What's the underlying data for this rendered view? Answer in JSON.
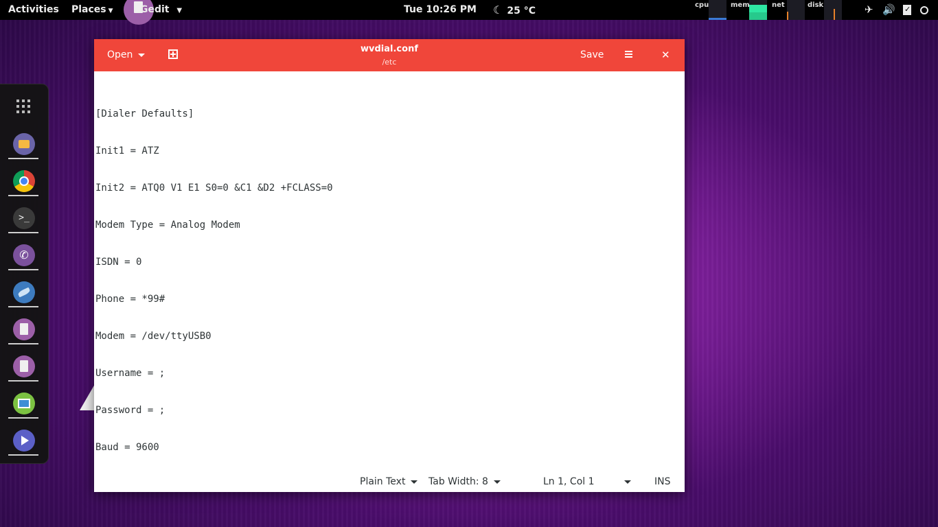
{
  "topbar": {
    "activities": "Activities",
    "places": "Places",
    "app_name": "Gedit",
    "clock": "Tue 10:26 PM",
    "weather": "25 °C",
    "monitors": [
      {
        "label": "cpu"
      },
      {
        "label": "mem"
      },
      {
        "label": "net"
      },
      {
        "label": "disk"
      }
    ],
    "status_icons": [
      "airplane-mode-icon",
      "volume-icon",
      "clipboard-check-icon",
      "power-icon"
    ]
  },
  "dock": {
    "apps": [
      {
        "name": "files-icon"
      },
      {
        "name": "chrome-icon"
      },
      {
        "name": "terminal-icon"
      },
      {
        "name": "viber-icon"
      },
      {
        "name": "wireshark-icon"
      },
      {
        "name": "gedit-icon"
      },
      {
        "name": "gedit-icon"
      },
      {
        "name": "image-viewer-icon"
      },
      {
        "name": "video-player-icon"
      }
    ]
  },
  "window": {
    "open_label": "Open",
    "title": "wvdial.conf",
    "subtitle": "/etc",
    "save_label": "Save",
    "close_label": "✕"
  },
  "editor": {
    "lines": [
      "[Dialer Defaults]",
      "Init1 = ATZ",
      "Init2 = ATQ0 V1 E1 S0=0 &C1 &D2 +FCLASS=0",
      "Modem Type = Analog Modem",
      "ISDN = 0",
      "Phone = *99#",
      "Modem = /dev/ttyUSB0",
      "Username = ;",
      "Password = ;",
      "Baud = 9600"
    ]
  },
  "statusbar": {
    "language": "Plain Text",
    "tab_width": "Tab Width: 8",
    "position": "Ln 1, Col 1",
    "mode": "INS"
  },
  "colors": {
    "headerbar": "#f0463a",
    "topbar": "#000000"
  }
}
